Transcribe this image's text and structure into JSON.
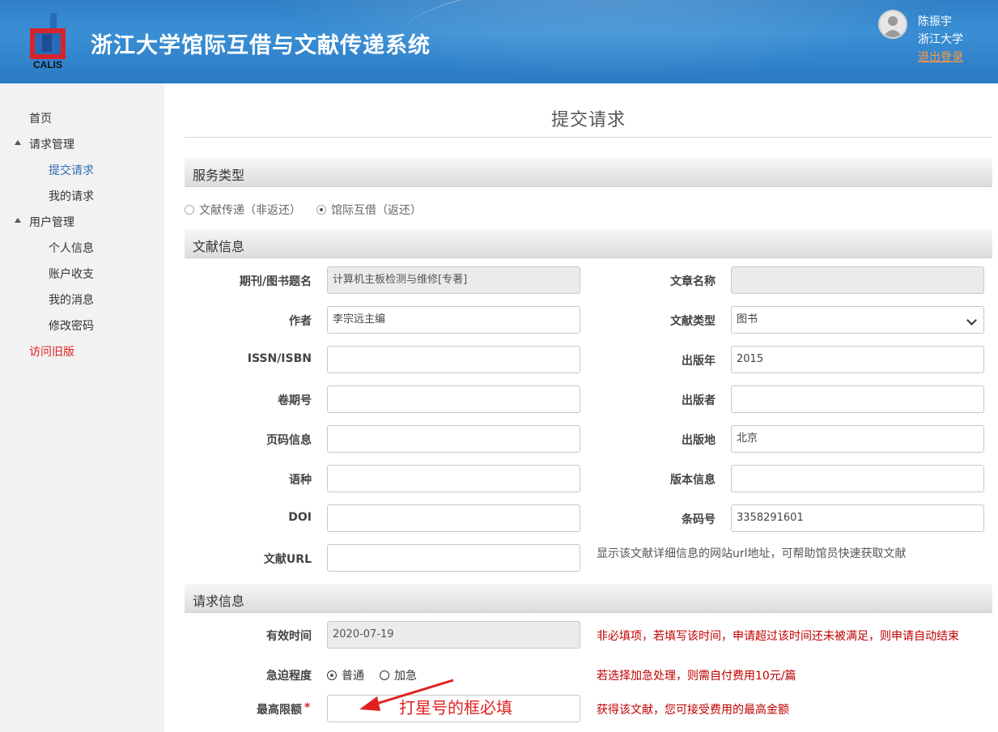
{
  "header": {
    "logo_text": "CALIS",
    "title": "浙江大学馆际互借与文献传递系统",
    "user_name": "陈振宇",
    "user_org": "浙江大学",
    "logout_label": "退出登录"
  },
  "sidebar": {
    "items": [
      {
        "label": "首页"
      },
      {
        "label": "请求管理"
      },
      {
        "label": "提交请求"
      },
      {
        "label": "我的请求"
      },
      {
        "label": "用户管理"
      },
      {
        "label": "个人信息"
      },
      {
        "label": "账户收支"
      },
      {
        "label": "我的消息"
      },
      {
        "label": "修改密码"
      },
      {
        "label": "访问旧版"
      }
    ]
  },
  "main": {
    "page_title": "提交请求",
    "service_section": "服务类型",
    "service_options": [
      {
        "label": "文献传递（非返还）",
        "checked": false
      },
      {
        "label": "馆际互借（返还）",
        "checked": true
      }
    ],
    "doc_section": "文献信息",
    "doc_fields": {
      "title_label": "期刊/图书题名",
      "title_value": "计算机主板检测与维修[专著]",
      "article_label": "文章名称",
      "article_value": "",
      "author_label": "作者",
      "author_value": "李宗远主编",
      "doctype_label": "文献类型",
      "doctype_value": "图书",
      "issn_label": "ISSN/ISBN",
      "issn_value": "",
      "year_label": "出版年",
      "year_value": "2015",
      "volume_label": "卷期号",
      "volume_value": "",
      "publisher_label": "出版者",
      "publisher_value": "",
      "pages_label": "页码信息",
      "pages_value": "",
      "place_label": "出版地",
      "place_value": "北京",
      "lang_label": "语种",
      "lang_value": "",
      "edition_label": "版本信息",
      "edition_value": "",
      "doi_label": "DOI",
      "doi_value": "",
      "barcode_label": "条码号",
      "barcode_value": "3358291601",
      "url_label": "文献URL",
      "url_value": "",
      "url_hint": "显示该文献详细信息的网站url地址，可帮助馆员快速获取文献"
    },
    "request_section": "请求信息",
    "request_fields": {
      "valid_label": "有效时间",
      "valid_value": "2020-07-19",
      "valid_hint": "非必填项，若填写该时间，申请超过该时间还未被满足，则申请自动结束",
      "urgency_label": "急迫程度",
      "urgency_options": [
        {
          "label": "普通",
          "checked": true
        },
        {
          "label": "加急",
          "checked": false
        }
      ],
      "urgency_hint": "若选择加急处理，则需自付费用10元/篇",
      "max_label": "最高限额",
      "max_star": "*",
      "max_value": "",
      "max_hint": "获得该文献，您可接受费用的最高金额"
    },
    "annotation": "打星号的框必填"
  },
  "colors": {
    "header_blue": "#2f7fc6",
    "active_link": "#2e6db5",
    "alert_red": "#c00000",
    "logout_orange": "#ff9a3c"
  }
}
